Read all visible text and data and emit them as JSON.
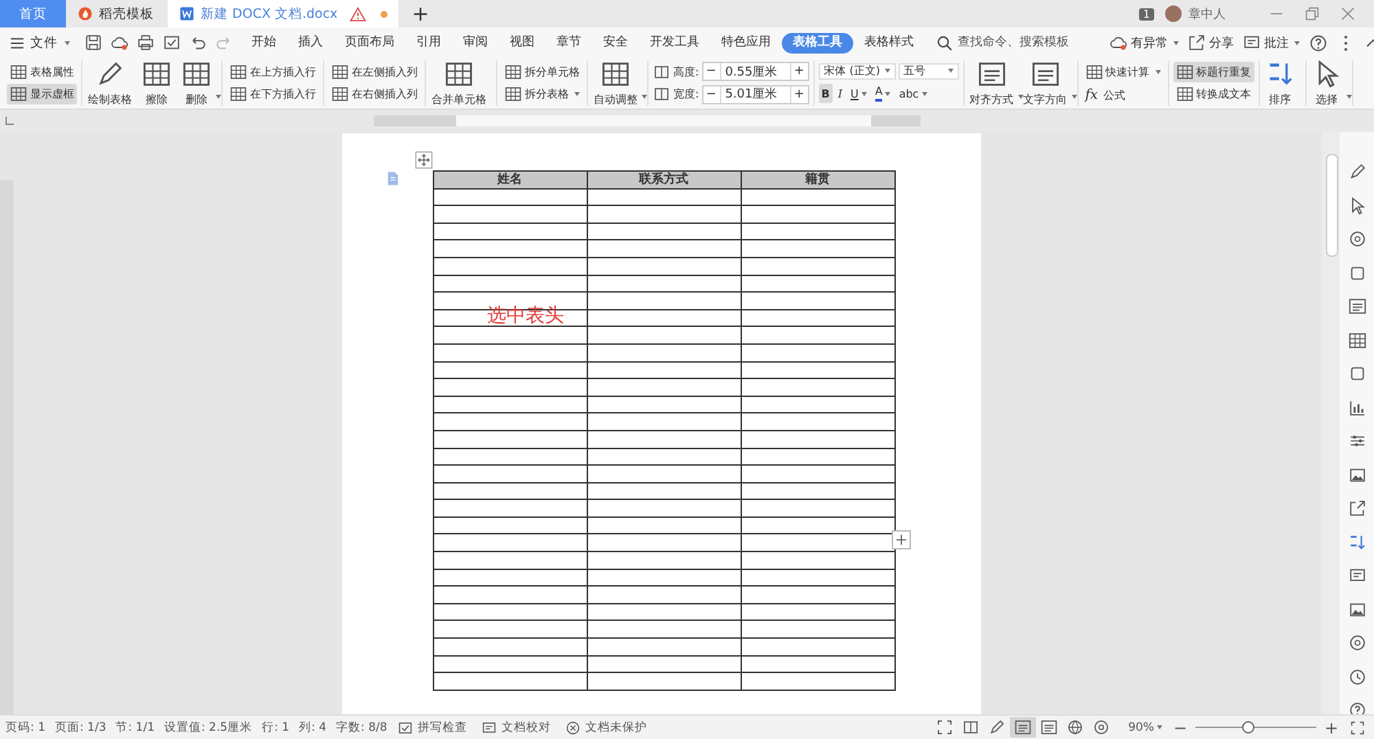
{
  "tabs": [
    {
      "label": "首页",
      "kind": "home",
      "selected": false
    },
    {
      "label": "稻壳模板",
      "kind": "template",
      "selected": false
    },
    {
      "label": "新建 DOCX 文档.docx",
      "kind": "doc",
      "selected": true,
      "warning": true,
      "unsaved": true
    }
  ],
  "new_tab": "+",
  "title_bar": {
    "badge": "1",
    "user": "章中人"
  },
  "menu": {
    "file": "文件",
    "items": [
      {
        "label": "开始",
        "selected": false
      },
      {
        "label": "插入",
        "selected": false
      },
      {
        "label": "页面布局",
        "selected": false
      },
      {
        "label": "引用",
        "selected": false
      },
      {
        "label": "审阅",
        "selected": false
      },
      {
        "label": "视图",
        "selected": false
      },
      {
        "label": "章节",
        "selected": false
      },
      {
        "label": "安全",
        "selected": false
      },
      {
        "label": "开发工具",
        "selected": false
      },
      {
        "label": "特色应用",
        "selected": false
      },
      {
        "label": "表格工具",
        "selected": true
      },
      {
        "label": "表格样式",
        "selected": false
      }
    ],
    "search": {
      "placeholder": "查找命令、搜索模板"
    },
    "right": [
      {
        "label": "有异常",
        "dropdown": true
      },
      {
        "label": "分享",
        "dropdown": false
      },
      {
        "label": "批注",
        "dropdown": true
      }
    ]
  },
  "ribbon": [
    {
      "kind": "stack",
      "items": [
        {
          "label": "表格属性",
          "on": false
        },
        {
          "label": "显示虚框",
          "on": true
        }
      ]
    },
    {
      "kind": "large",
      "items": [
        {
          "label": "绘制表格",
          "dropdown": false
        },
        {
          "label": "擦除",
          "dropdown": false
        },
        {
          "label": "删除",
          "dropdown": true
        }
      ]
    },
    {
      "kind": "stack",
      "items": [
        {
          "label": "在上方插入行",
          "on": false
        },
        {
          "label": "在下方插入行",
          "on": false
        }
      ]
    },
    {
      "kind": "stack",
      "items": [
        {
          "label": "在左侧插入列",
          "on": false
        },
        {
          "label": "在右侧插入列",
          "on": false
        }
      ]
    },
    {
      "kind": "large",
      "items": [
        {
          "label": "合并单元格",
          "dropdown": false
        }
      ]
    },
    {
      "kind": "stack",
      "items": [
        {
          "label": "拆分单元格",
          "on": false
        },
        {
          "label": "拆分表格",
          "on": false,
          "dropdown": true
        }
      ]
    },
    {
      "kind": "large",
      "items": [
        {
          "label": "自动调整",
          "dropdown": true
        }
      ]
    },
    {
      "kind": "size",
      "items": [
        {
          "label": "高度:",
          "value": "0.55厘米",
          "minus": "−",
          "plus": "+"
        },
        {
          "label": "宽度:",
          "value": "5.01厘米",
          "minus": "−",
          "plus": "+"
        }
      ]
    },
    {
      "kind": "font",
      "font": "宋体 (正文)",
      "size": "五号",
      "styles": [
        {
          "label": "B",
          "on": true,
          "dropdown": false
        },
        {
          "label": "I",
          "on": false,
          "dropdown": false
        },
        {
          "label": "U",
          "on": false,
          "dropdown": true
        },
        {
          "label": "A",
          "on": false,
          "dropdown": true
        },
        {
          "label": "abc",
          "on": false,
          "dropdown": true
        }
      ]
    },
    {
      "kind": "large",
      "items": [
        {
          "label": "对齐方式",
          "dropdown": true
        },
        {
          "label": "文字方向",
          "dropdown": true
        }
      ]
    },
    {
      "kind": "stack",
      "items": [
        {
          "label": "快速计算",
          "on": false,
          "dropdown": true
        },
        {
          "label": "公式",
          "on": false,
          "prefix": "fx"
        }
      ]
    },
    {
      "kind": "stack",
      "items": [
        {
          "label": "标题行重复",
          "on": true
        },
        {
          "label": "转换成文本",
          "on": false
        }
      ]
    },
    {
      "kind": "large",
      "items": [
        {
          "label": "排序",
          "dropdown": false
        }
      ]
    },
    {
      "kind": "large",
      "items": [
        {
          "label": "选择",
          "dropdown": true
        }
      ]
    }
  ],
  "document": {
    "table": {
      "header_selected": true,
      "columns": [
        "姓名",
        "联系方式",
        "籍贯"
      ]
    },
    "annotation": "选中表头"
  },
  "status_bar": {
    "items": [
      "页码: 1",
      "页面: 1/3",
      "节: 1/1",
      "设置值: 2.5厘米",
      "行: 1",
      "列: 4",
      "字数: 8/8"
    ],
    "tools": [
      "拼写检查",
      "文档校对",
      "文档未保护"
    ],
    "views": [
      {
        "selected": false
      },
      {
        "selected": false
      },
      {
        "selected": false
      },
      {
        "selected": true
      },
      {
        "selected": false
      },
      {
        "selected": false
      },
      {
        "selected": false
      }
    ],
    "zoom": {
      "value": "90%",
      "level": 0.43,
      "minus": "−",
      "plus": "+"
    }
  }
}
